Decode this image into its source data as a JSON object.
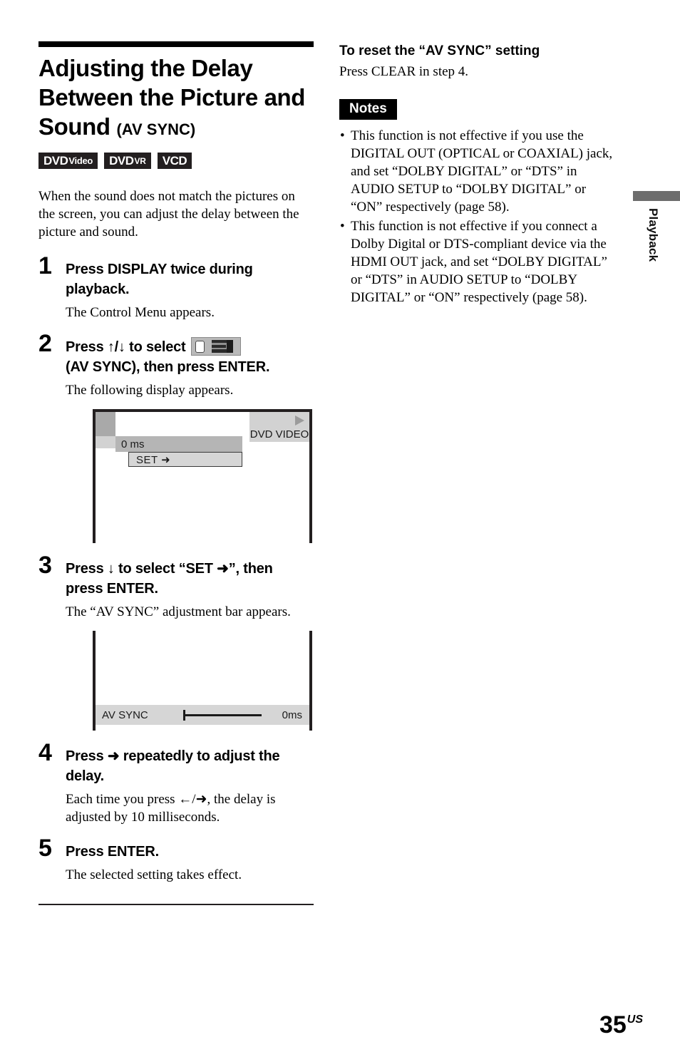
{
  "document": {
    "page_number": "35",
    "page_region": "US",
    "side_tab_label": "Playback"
  },
  "left_column": {
    "title_line1": "Adjusting the Delay",
    "title_line2": "Between the Picture and",
    "title_line3": "Sound",
    "title_suffix": "(AV SYNC)",
    "badges": [
      {
        "main": "DVD",
        "sub": "Video",
        "sub_size": "small"
      },
      {
        "main": "DVD",
        "sub": "VR",
        "sub_size": "xsmall"
      },
      {
        "main": "VCD",
        "sub": "",
        "sub_size": "small"
      }
    ],
    "intro": "When the sound does not match the pictures on the screen, you can adjust the delay between the picture and sound.",
    "steps": [
      {
        "number": "1",
        "heading": "Press DISPLAY twice during playback.",
        "description": "The Control Menu appears."
      },
      {
        "number": "2",
        "heading_part1": "Press ↑/↓ to select",
        "heading_part2": "(AV SYNC), then press ENTER.",
        "icon": "av-sync-control-menu-icon",
        "description": "The following display appears."
      },
      {
        "number": "3",
        "heading": "Press ↓ to select “SET ➜”, then press ENTER.",
        "description": "The “AV SYNC” adjustment bar appears."
      },
      {
        "number": "4",
        "heading": "Press ➜ repeatedly to adjust the delay.",
        "description": "Each time you press ←/➜, the delay is adjusted by 10 milliseconds."
      },
      {
        "number": "5",
        "heading": "Press ENTER.",
        "description": "The selected setting takes effect."
      }
    ],
    "screen_control_menu": {
      "value_label": "0 ms",
      "set_label": "SET  ➜",
      "disc_type": "DVD VIDEO"
    },
    "screen_adjust_bar": {
      "bar_label": "AV SYNC",
      "bar_value": "0ms"
    }
  },
  "right_column": {
    "reset_heading": "To reset the “AV SYNC” setting",
    "reset_text": "Press CLEAR in step 4.",
    "notes_tag": "Notes",
    "notes": [
      "This function is not effective if you use the DIGITAL OUT (OPTICAL or COAXIAL) jack, and set “DOLBY DIGITAL” or “DTS” in AUDIO SETUP to “DOLBY DIGITAL” or “ON” respectively (page 58).",
      "This function is not effective if you connect a Dolby Digital or DTS-compliant device via the HDMI OUT jack, and set “DOLBY DIGITAL” or “DTS” in AUDIO SETUP to “DOLBY DIGITAL” or “ON” respectively (page 58)."
    ]
  },
  "colors": {
    "ink": "#231f20",
    "screen_gray_dark": "#a9a9a9",
    "screen_gray_mid": "#b5b5b5",
    "screen_gray_light": "#d2d2d2",
    "tab_gray": "#6d6d6d"
  }
}
